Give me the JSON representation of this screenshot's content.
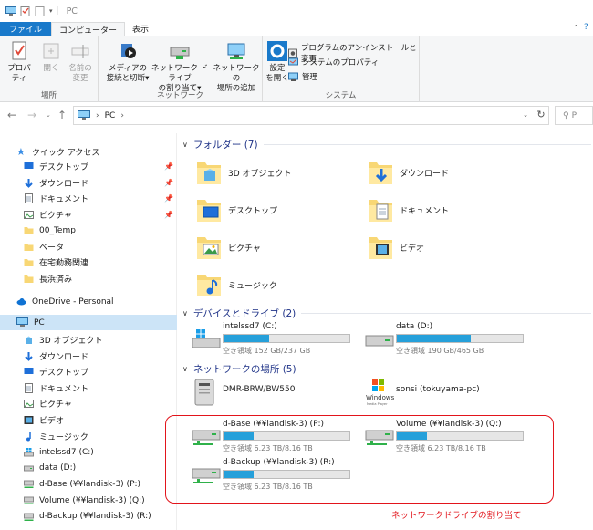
{
  "window": {
    "title": "PC"
  },
  "ribbon_tabs": [
    "ファイル",
    "コンピューター",
    "表示"
  ],
  "ribbon": {
    "location": {
      "label": "場所",
      "buttons": [
        {
          "label1": "プロパティ",
          "label2": "",
          "icon": "properties-icon"
        },
        {
          "label1": "開く",
          "label2": "",
          "icon": "open-icon"
        },
        {
          "label1": "名前の",
          "label2": "変更",
          "icon": "rename-icon"
        }
      ]
    },
    "network": {
      "label": "ネットワーク",
      "buttons": [
        {
          "label1": "メディアの",
          "label2": "接続と切断▾",
          "icon": "media-icon"
        },
        {
          "label1": "ネットワーク ドライブ",
          "label2": "の割り当て▾",
          "icon": "map-drive-icon"
        },
        {
          "label1": "ネットワークの",
          "label2": "場所の追加",
          "icon": "add-location-icon"
        }
      ]
    },
    "system": {
      "label": "システム",
      "settings": {
        "label1": "設定",
        "label2": "を開く"
      },
      "small": [
        "プログラムのアンインストールと変更",
        "システムのプロパティ",
        "管理"
      ]
    }
  },
  "address": {
    "path": "PC",
    "search_placeholder": "P"
  },
  "nav_pane": {
    "quick_access": "クイック アクセス",
    "quick_items": [
      "デスクトップ",
      "ダウンロード",
      "ドキュメント",
      "ピクチャ",
      "00_Temp",
      "ベータ",
      "在宅勤務関連",
      "長浜済み"
    ],
    "onedrive": "OneDrive - Personal",
    "pc": "PC",
    "pc_items": [
      "3D オブジェクト",
      "ダウンロード",
      "デスクトップ",
      "ドキュメント",
      "ピクチャ",
      "ビデオ",
      "ミュージック",
      "intelssd7 (C:)",
      "data (D:)",
      "d-Base (¥¥landisk-3) (P:)",
      "Volume (¥¥landisk-3) (Q:)",
      "d-Backup (¥¥landisk-3) (R:)"
    ]
  },
  "sections": {
    "folders": "フォルダー (7)",
    "devices": "デバイスとドライブ (2)",
    "network": "ネットワークの場所 (5)"
  },
  "folders": [
    "3D オブジェクト",
    "ダウンロード",
    "デスクトップ",
    "ドキュメント",
    "ピクチャ",
    "ビデオ",
    "ミュージック"
  ],
  "drives": [
    {
      "name": "intelssd7 (C:)",
      "free": "空き領域 152 GB/237 GB",
      "used_fraction": 0.36
    },
    {
      "name": "data (D:)",
      "free": "空き領域 190 GB/465 GB",
      "used_fraction": 0.59
    }
  ],
  "network_locations": [
    {
      "name": "DMR-BRW/BW550"
    },
    {
      "name": "sonsi (tokuyama-pc)"
    },
    {
      "name": "d-Base (¥¥landisk-3) (P:)",
      "free": "空き領域 6.23 TB/8.16 TB",
      "used_fraction": 0.24
    },
    {
      "name": "Volume (¥¥landisk-3) (Q:)",
      "free": "空き領域 6.23 TB/8.16 TB",
      "used_fraction": 0.24
    },
    {
      "name": "d-Backup (¥¥landisk-3) (R:)",
      "free": "空き領域 6.23 TB/8.16 TB",
      "used_fraction": 0.24
    }
  ],
  "annotation": "ネットワークドライブの割り当て",
  "windows_media_player_logo_text": "Windows Media Player",
  "colors": {
    "accent": "#1979ca",
    "selection": "#cce4f7",
    "bar_fill": "#26a0da",
    "annotation": "#e2141b",
    "section_title": "#1e3287"
  }
}
